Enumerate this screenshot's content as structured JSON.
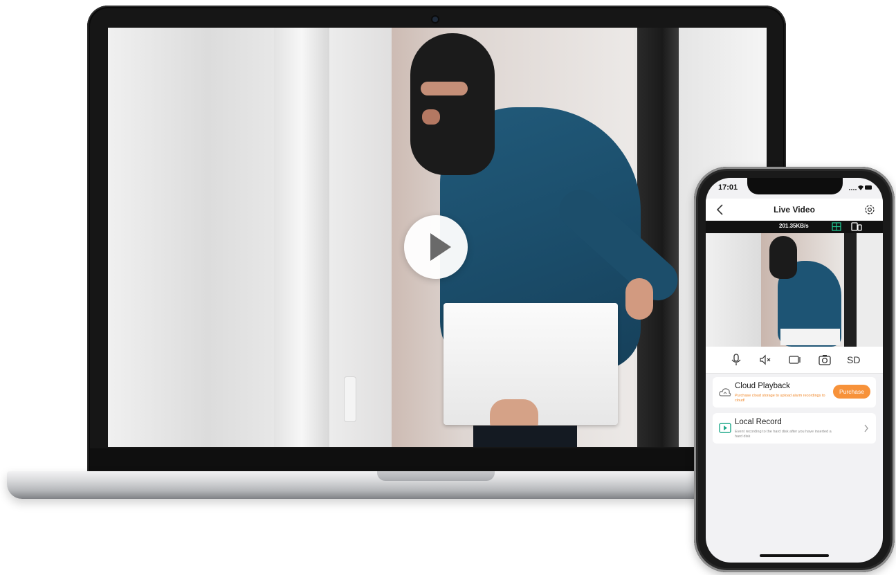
{
  "laptop": {
    "video": {
      "play_icon": "play-icon"
    }
  },
  "phone": {
    "status_bar": {
      "time": "17:01",
      "icons": [
        "signal-icon",
        "wifi-icon",
        "battery-icon"
      ]
    },
    "nav": {
      "title": "Live Video",
      "back_icon": "chevron-left-icon",
      "settings_icon": "gear-icon"
    },
    "video_toolbar": {
      "bitrate": "201.35KB/s",
      "icons": [
        "grid-view-icon",
        "split-view-icon"
      ]
    },
    "controls": {
      "icons": [
        "microphone-icon",
        "mute-icon",
        "record-icon",
        "camera-icon"
      ],
      "quality_label": "SD"
    },
    "cards": [
      {
        "title": "Cloud Playback",
        "subtitle": "Purchase cloud storage to upload alarm recordings to cloud!",
        "button_label": "Purchase",
        "icon": "cloud-icon"
      },
      {
        "title": "Local Record",
        "subtitle": "Event recording to the hard disk after you have inserted a hard disk",
        "icon": "local-record-icon"
      }
    ]
  },
  "colors": {
    "accent_orange": "#f7923a",
    "local_record_green": "#1fa98a",
    "toolbar_green": "#20c38f"
  }
}
